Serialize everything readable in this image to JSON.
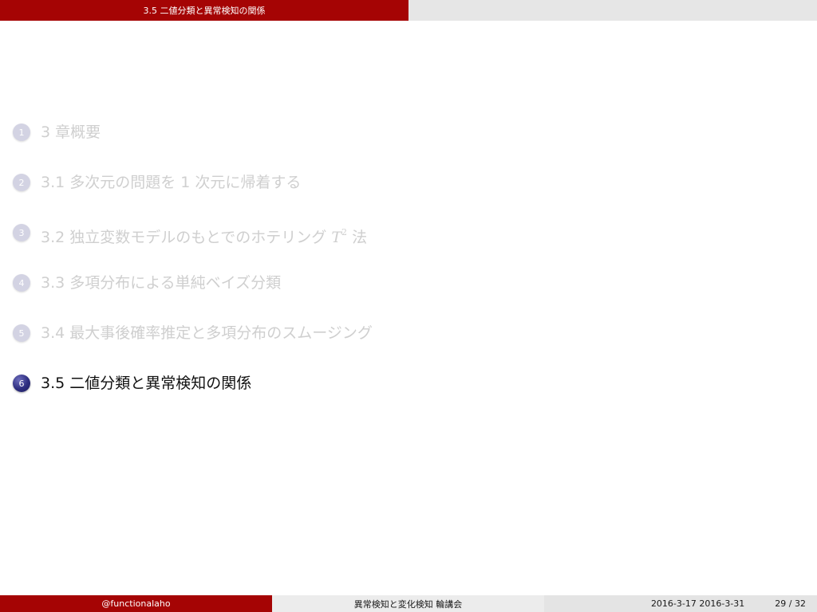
{
  "header": {
    "section_title": "3.5 二値分類と異常検知の関係"
  },
  "outline": {
    "items": [
      {
        "number": "1",
        "label": "3 章概要"
      },
      {
        "number": "2",
        "label": "3.1 多次元の問題を 1 次元に帰着する"
      },
      {
        "number": "3",
        "label_prefix": "3.2 独立変数モデルのもとでのホテリング ",
        "math_base": "T",
        "math_sup": "2",
        "label_suffix": " 法"
      },
      {
        "number": "4",
        "label": "3.3 多項分布による単純ベイズ分類"
      },
      {
        "number": "5",
        "label": "3.4 最大事後確率推定と多項分布のスムージング"
      },
      {
        "number": "6",
        "label": "3.5 二値分類と異常検知の関係"
      }
    ],
    "active_index": 6
  },
  "footer": {
    "author": "@functionalaho",
    "title": "異常検知と変化検知 輪講会",
    "date": "2016-3-17 2016-3-31",
    "page": "29 / 32"
  },
  "colors": {
    "accent": "#a50404",
    "bullet_active": "#2e2e80",
    "bullet_inactive": "#d3d3e3",
    "text_inactive": "#cfcfcf"
  }
}
